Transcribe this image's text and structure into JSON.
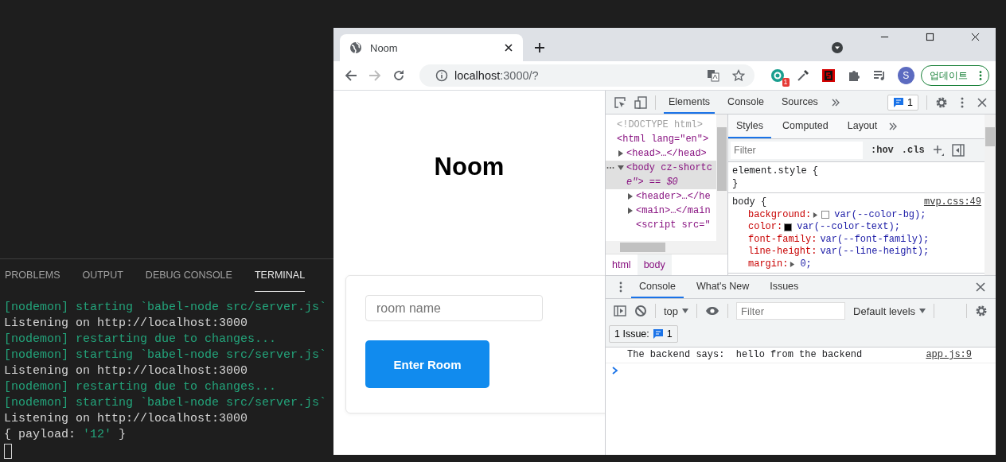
{
  "terminal": {
    "tabs": [
      {
        "label": "PROBLEMS",
        "selected": false
      },
      {
        "label": "OUTPUT",
        "selected": false
      },
      {
        "label": "DEBUG CONSOLE",
        "selected": false
      },
      {
        "label": "TERMINAL",
        "selected": true
      }
    ],
    "lines": [
      {
        "parts": [
          {
            "text": "[nodemon] starting `babel-node src/server.js`",
            "kind": "info"
          }
        ]
      },
      {
        "parts": [
          {
            "text": "Listening on http://localhost:3000",
            "kind": "plain"
          }
        ]
      },
      {
        "parts": [
          {
            "text": "[nodemon] restarting due to changes...",
            "kind": "info"
          }
        ]
      },
      {
        "parts": [
          {
            "text": "[nodemon] starting `babel-node src/server.js`",
            "kind": "info"
          }
        ]
      },
      {
        "parts": [
          {
            "text": "Listening on http://localhost:3000",
            "kind": "plain"
          }
        ]
      },
      {
        "parts": [
          {
            "text": "[nodemon] restarting due to changes...",
            "kind": "info"
          }
        ]
      },
      {
        "parts": [
          {
            "text": "[nodemon] starting `babel-node src/server.js`",
            "kind": "info"
          }
        ]
      },
      {
        "parts": [
          {
            "text": "Listening on http://localhost:3000",
            "kind": "plain"
          }
        ]
      },
      {
        "parts": [
          {
            "text": "{ payload: ",
            "kind": "plain"
          },
          {
            "text": "'12'",
            "kind": "string"
          },
          {
            "text": " }",
            "kind": "plain"
          }
        ]
      }
    ]
  },
  "browser": {
    "tab": {
      "title": "Noom"
    },
    "address": {
      "host": "localhost",
      "rest": ":3000/?"
    },
    "extension_badge": "1",
    "avatar": "S",
    "update_button": "업데이트",
    "page": {
      "heading": "Noom",
      "room_input": {
        "placeholder": "room name"
      },
      "enter_button": "Enter Room"
    },
    "devtools": {
      "tabs": [
        {
          "label": "Elements",
          "selected": true
        },
        {
          "label": "Console",
          "selected": false
        },
        {
          "label": "Sources",
          "selected": false
        }
      ],
      "issues_count": "1",
      "tree": [
        {
          "text": "<!DOCTYPE html>",
          "kind": "doctype"
        },
        {
          "text": "<html lang=\"en\">",
          "kind": "tag",
          "children": [
            {
              "text": "<head>…</head>",
              "kind": "tag",
              "expanded": false
            },
            {
              "text": "<body cz-shortc",
              "continuation": "e\"> == $0",
              "kind": "tag",
              "expanded": true,
              "selected": true,
              "children": [
                {
                  "text": "<header>…</he",
                  "kind": "tag",
                  "expanded": false
                },
                {
                  "text": "<main>…</main",
                  "kind": "tag",
                  "expanded": false
                },
                {
                  "text": "<script src=\"",
                  "kind": "tag"
                }
              ]
            }
          ]
        }
      ],
      "breadcrumbs": [
        {
          "label": "html",
          "selected": false
        },
        {
          "label": "body",
          "selected": true
        }
      ],
      "styles_tabs": [
        {
          "label": "Styles",
          "selected": true
        },
        {
          "label": "Computed",
          "selected": false
        },
        {
          "label": "Layout",
          "selected": false
        }
      ],
      "styles_filter": {
        "placeholder": "Filter"
      },
      "hov": ":hov",
      "cls": ".cls",
      "rules": [
        {
          "header": "element.style {",
          "footer": "}"
        },
        {
          "header": "body {",
          "source": "mvp.css:49",
          "properties": [
            {
              "name": "background:",
              "value": "var(--color-bg);",
              "expandable": true,
              "color": "#ffffff"
            },
            {
              "name": "color:",
              "value": "var(--color-text);",
              "color": "#000000"
            },
            {
              "name": "font-family:",
              "value": "var(--font-family);"
            },
            {
              "name": "line-height:",
              "value": "var(--line-height);"
            },
            {
              "name": "margin:",
              "value": "0;",
              "expandable": true
            }
          ]
        }
      ],
      "drawer": {
        "tabs": [
          {
            "label": "Console",
            "selected": true
          },
          {
            "label": "What's New",
            "selected": false
          },
          {
            "label": "Issues",
            "selected": false
          }
        ],
        "context": "top",
        "filter": {
          "placeholder": "Filter"
        },
        "levels": "Default levels",
        "issues_button": {
          "label": "1 Issue:",
          "count": "1"
        },
        "messages": [
          {
            "text": "The backend says:  hello from the backend",
            "source": "app.js:9"
          }
        ]
      }
    }
  }
}
